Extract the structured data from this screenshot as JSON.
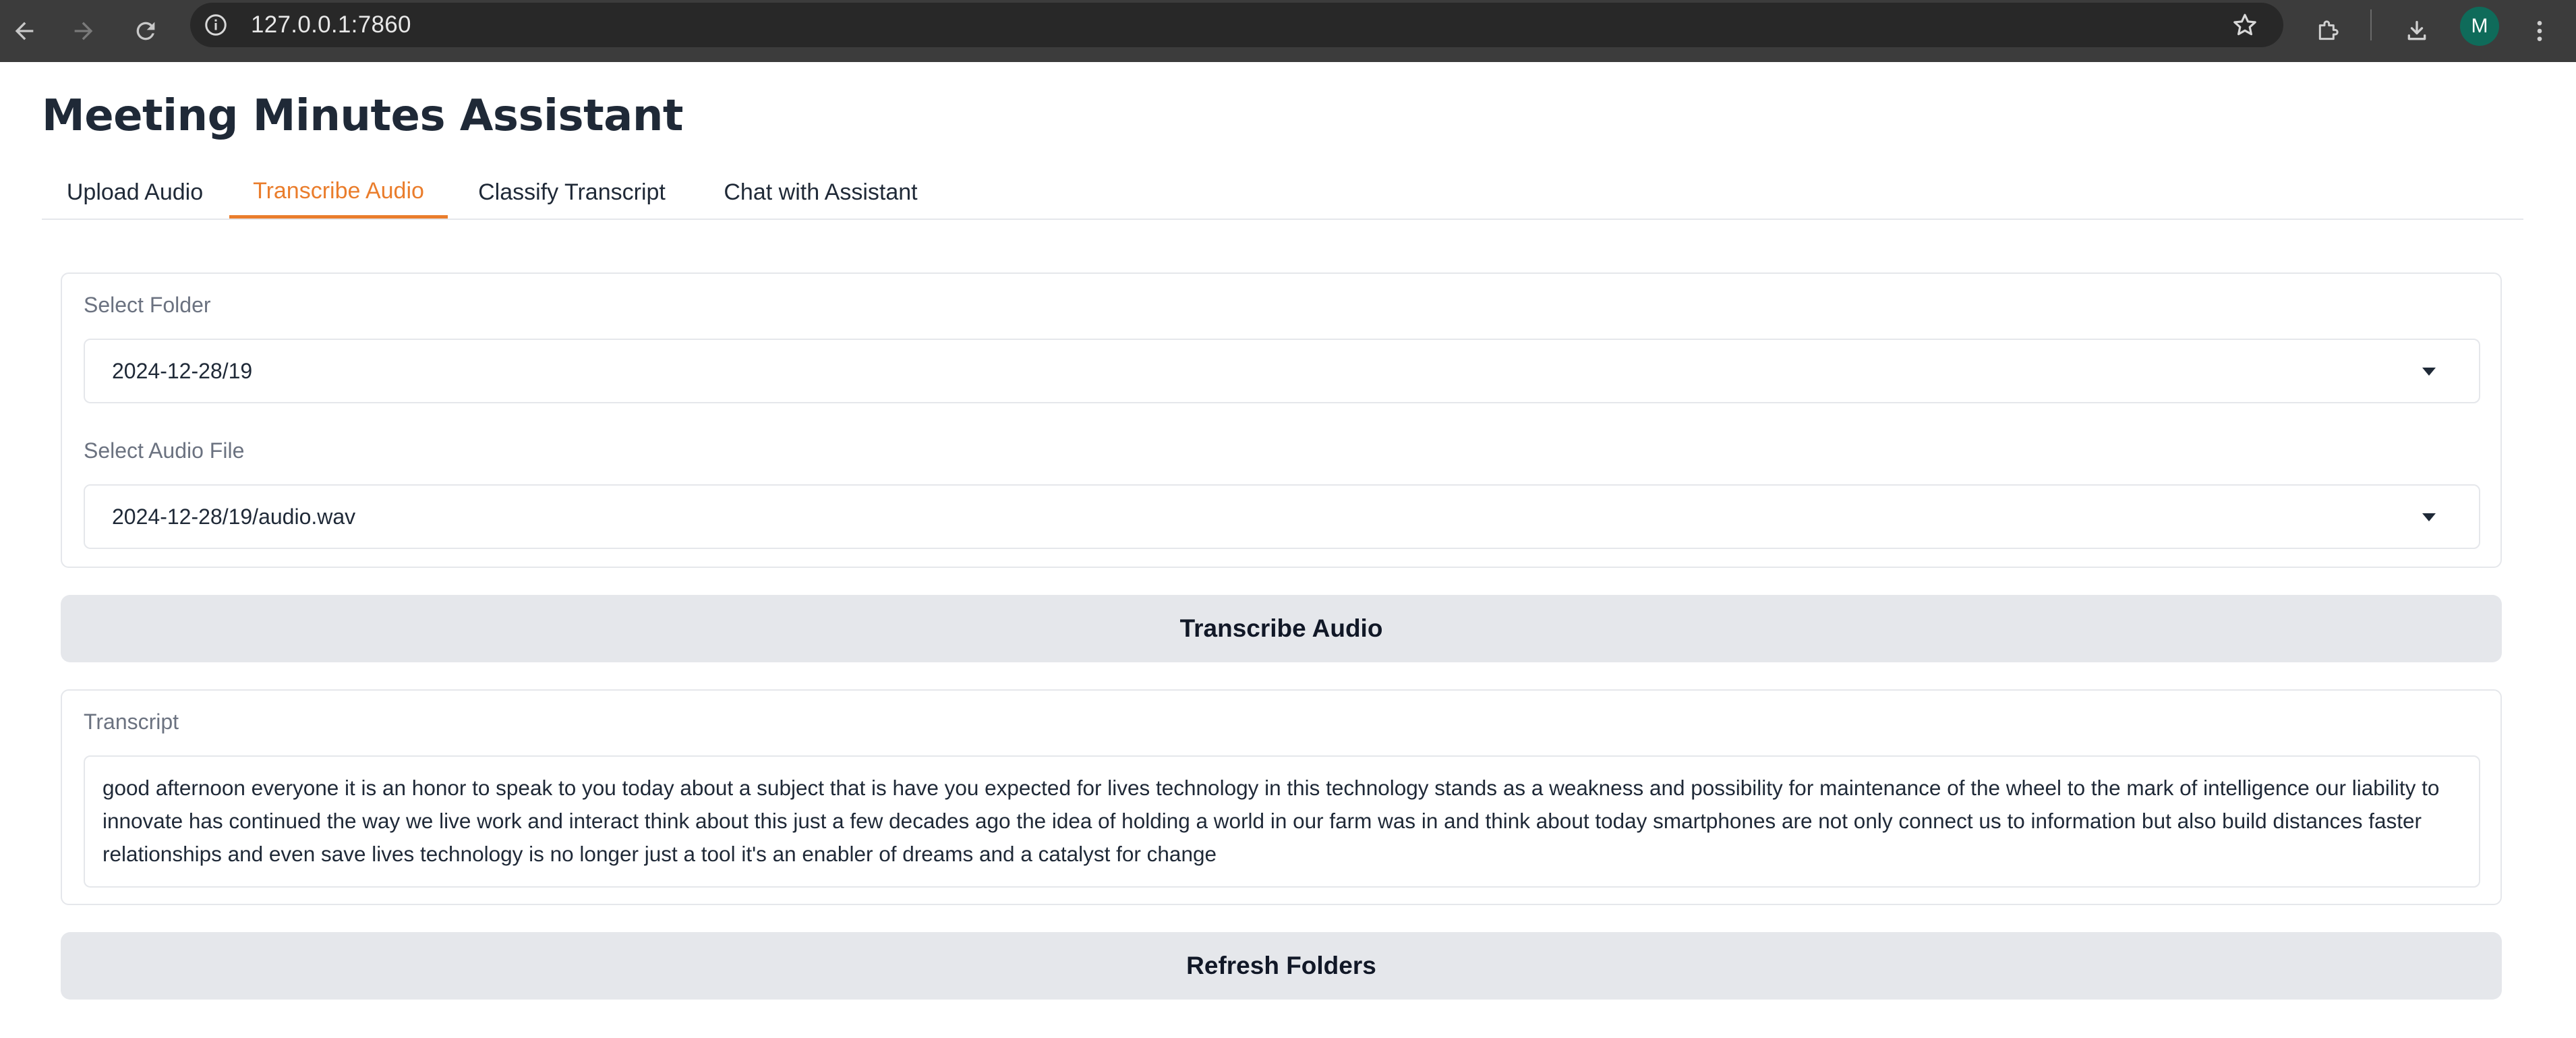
{
  "browser": {
    "url": "127.0.0.1:7860",
    "profile_initial": "M",
    "icons": {
      "back": "arrow-left-icon",
      "forward": "arrow-right-icon",
      "reload": "reload-icon",
      "site_info": "info-icon",
      "bookmark": "star-icon",
      "extensions": "puzzle-icon",
      "downloads": "download-icon",
      "menu": "kebab-menu-icon"
    }
  },
  "app": {
    "title": "Meeting Minutes Assistant",
    "accent_color": "#ea7d2c"
  },
  "tabs": [
    {
      "label": "Upload Audio",
      "active": false
    },
    {
      "label": "Transcribe Audio",
      "active": true
    },
    {
      "label": "Classify Transcript",
      "active": false
    },
    {
      "label": "Chat with Assistant",
      "active": false
    }
  ],
  "select_folder": {
    "label": "Select Folder",
    "value": "2024-12-28/19"
  },
  "select_audio": {
    "label": "Select Audio File",
    "value": "2024-12-28/19/audio.wav"
  },
  "transcribe_button": {
    "label": "Transcribe Audio"
  },
  "transcript": {
    "label": "Transcript",
    "text": "good afternoon everyone it is an honor to speak to you today about a subject that is have you expected for lives  technology in this technology stands as a weakness and possibility for maintenance of the wheel to the mark of intelligence our liability to innovate has continued  the way we live work and interact think about this just a few decades ago the idea of holding a world in our farm was in  and think about today smartphones are not only connect us to information but also build distances faster relationships and even save lives technology is no longer just a tool it's an enabler of dreams and a catalyst for change"
  },
  "refresh_button": {
    "label": "Refresh Folders"
  }
}
